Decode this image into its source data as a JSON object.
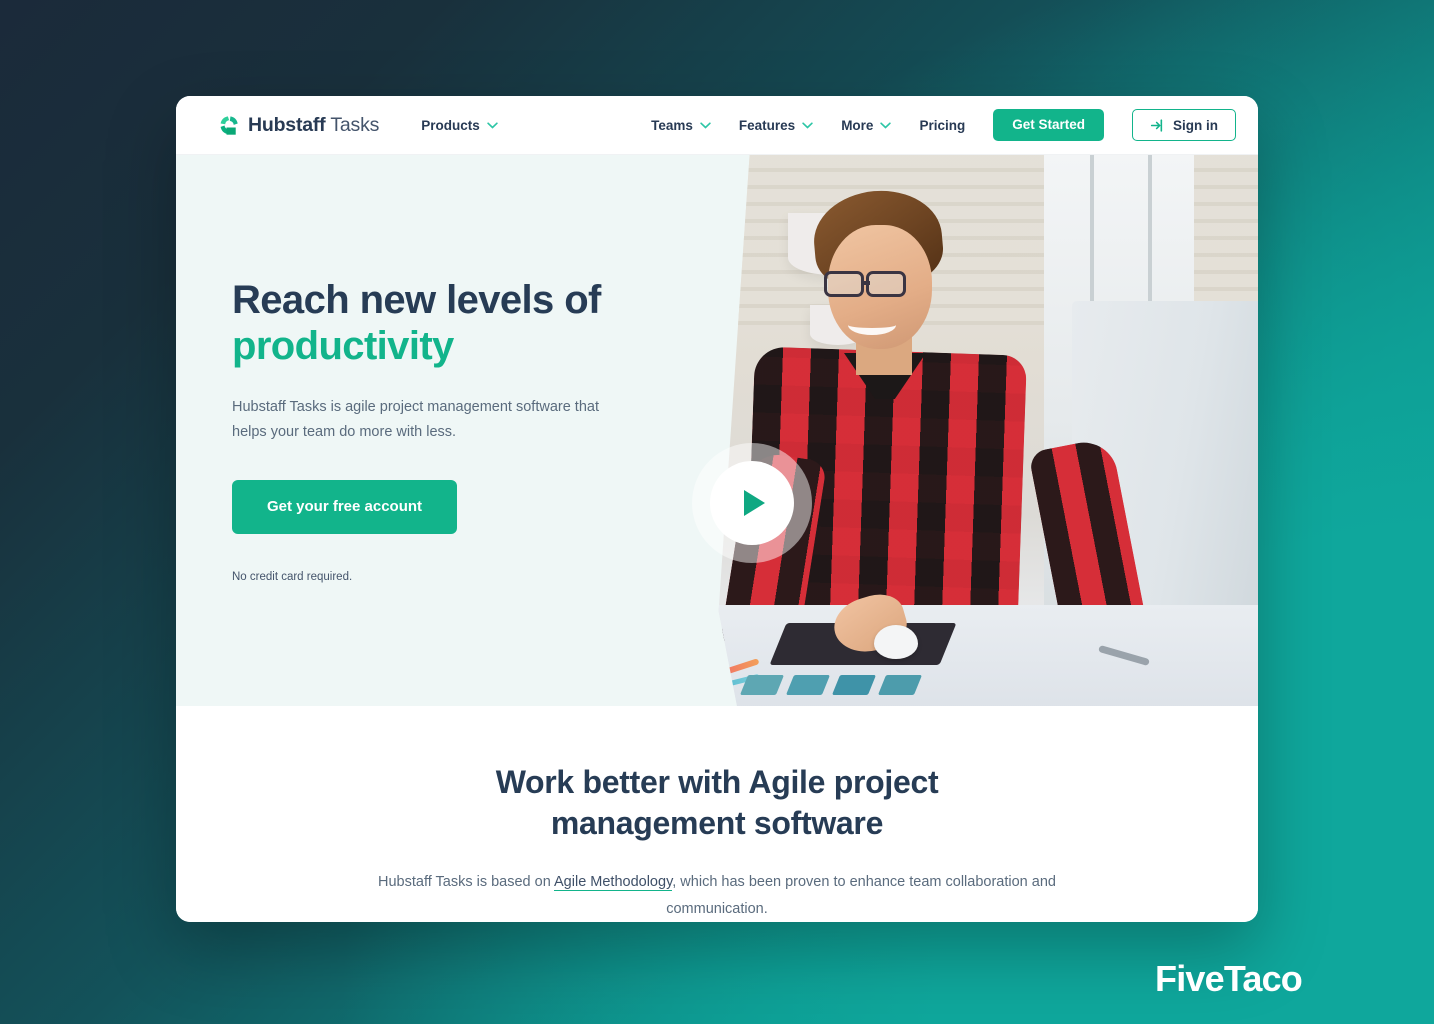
{
  "brand": {
    "name_bold": "Hubstaff",
    "name_light": "Tasks",
    "logo_icon": "hubstaff-pinwheel-logo"
  },
  "nav": {
    "left_items": [
      {
        "label": "Products",
        "icon": "chevron-down-icon"
      }
    ],
    "right_items": [
      {
        "label": "Teams",
        "icon": "chevron-down-icon"
      },
      {
        "label": "Features",
        "icon": "chevron-down-icon"
      },
      {
        "label": "More",
        "icon": "chevron-down-icon"
      },
      {
        "label": "Pricing",
        "icon": ""
      }
    ],
    "get_started_label": "Get Started",
    "sign_in_label": "Sign in",
    "sign_in_icon": "sign-in-arrow-icon"
  },
  "hero": {
    "title_line1": "Reach new levels of",
    "title_line2": "productivity",
    "subtitle": "Hubstaff Tasks is agile project management software that helps your team do more with less.",
    "cta_label": "Get your free account",
    "note": "No credit card required.",
    "play_icon": "play-button-icon",
    "photo_alt": "man-in-red-plaid-shirt-working-at-desk"
  },
  "section": {
    "title": "Work better with Agile project management software",
    "body_before_link": "Hubstaff Tasks is based on ",
    "link_label": "Agile Methodology",
    "body_after_link": ", which has been proven to enhance team collaboration and communication."
  },
  "watermark": {
    "label": "FiveTaco"
  },
  "colors": {
    "accent_green": "#12b48b",
    "navy_text": "#273c55",
    "hero_bg": "#eff7f6",
    "page_teal": "#0fa79c",
    "page_navy": "#1b2a3a"
  }
}
